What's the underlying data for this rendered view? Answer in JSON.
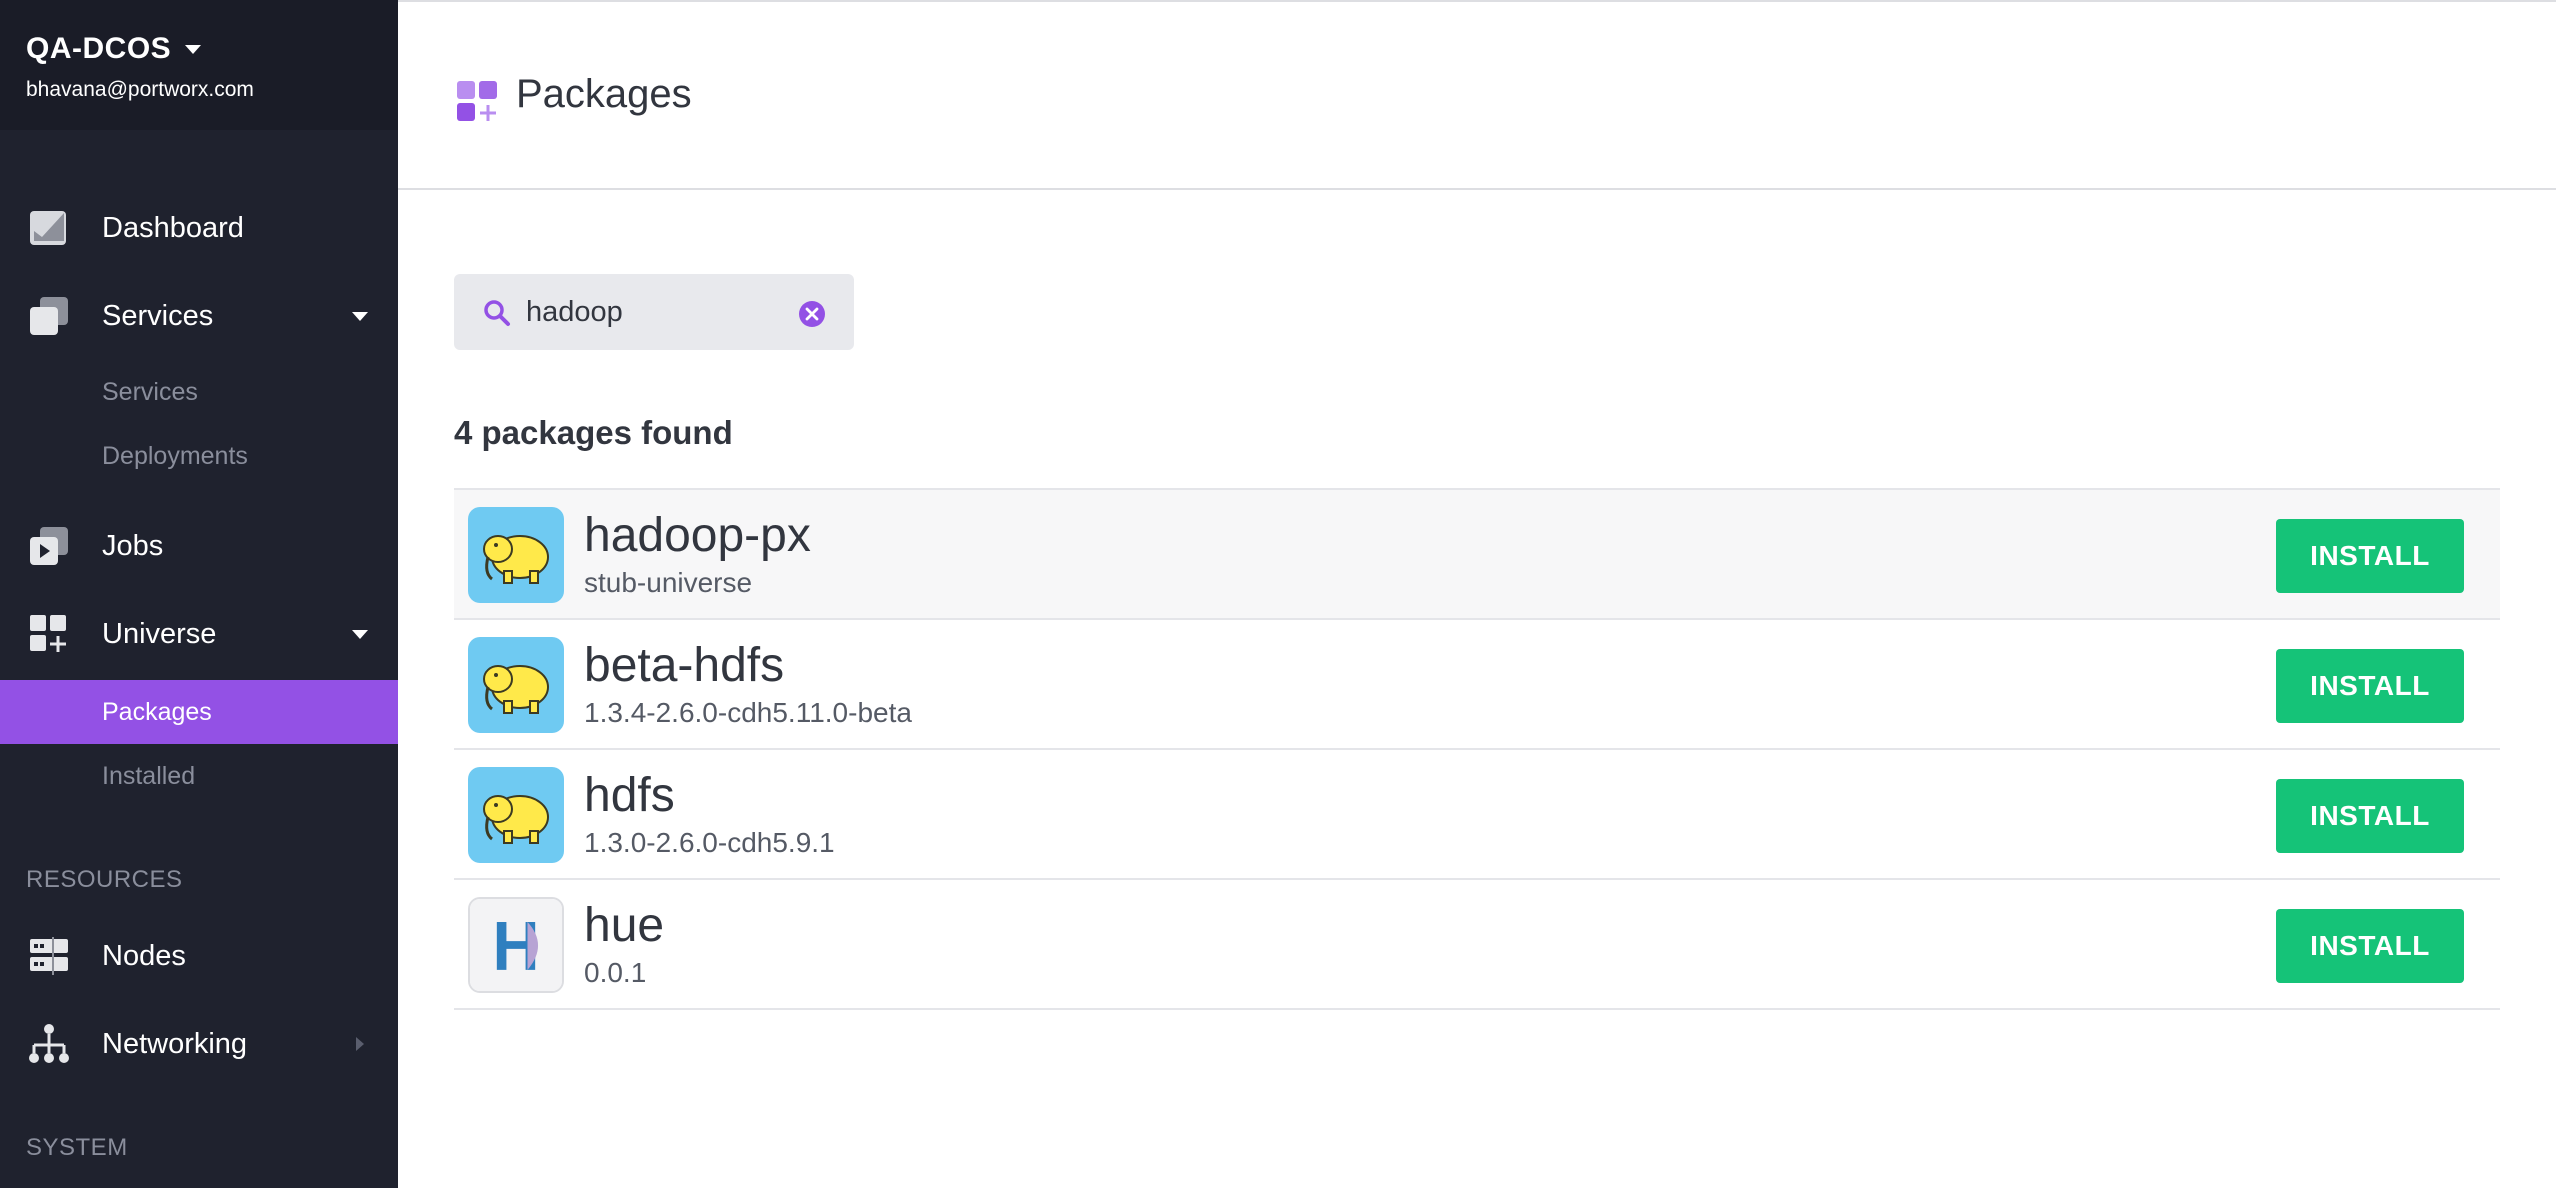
{
  "sidebar": {
    "cluster_name": "QA-DCOS",
    "user_email": "bhavana@portworx.com",
    "items": [
      {
        "label": "Dashboard"
      },
      {
        "label": "Services"
      },
      {
        "label": "Jobs"
      },
      {
        "label": "Universe"
      },
      {
        "label": "Nodes"
      },
      {
        "label": "Networking"
      }
    ],
    "services_sub": [
      "Services",
      "Deployments"
    ],
    "universe_sub": [
      "Packages",
      "Installed"
    ],
    "active_sub_item": "Packages",
    "sections": {
      "resources": "RESOURCES",
      "system": "SYSTEM"
    }
  },
  "header": {
    "title": "Packages"
  },
  "search": {
    "value": "hadoop"
  },
  "results": {
    "count_text": "4 packages found",
    "packages": [
      {
        "name": "hadoop-px",
        "version": "stub-universe",
        "action": "INSTALL",
        "icon": "hadoop-elephant-icon"
      },
      {
        "name": "beta-hdfs",
        "version": "1.3.4-2.6.0-cdh5.11.0-beta",
        "action": "INSTALL",
        "icon": "hadoop-elephant-icon"
      },
      {
        "name": "hdfs",
        "version": "1.3.0-2.6.0-cdh5.9.1",
        "action": "INSTALL",
        "icon": "hadoop-elephant-icon"
      },
      {
        "name": "hue",
        "version": "0.0.1",
        "action": "INSTALL",
        "icon": "hue-logo-icon"
      }
    ]
  },
  "colors": {
    "sidebar_bg": "#1f222e",
    "active_purple": "#9351e5",
    "install_green": "#15c378",
    "hadoop_tile": "#6fcaf2"
  }
}
